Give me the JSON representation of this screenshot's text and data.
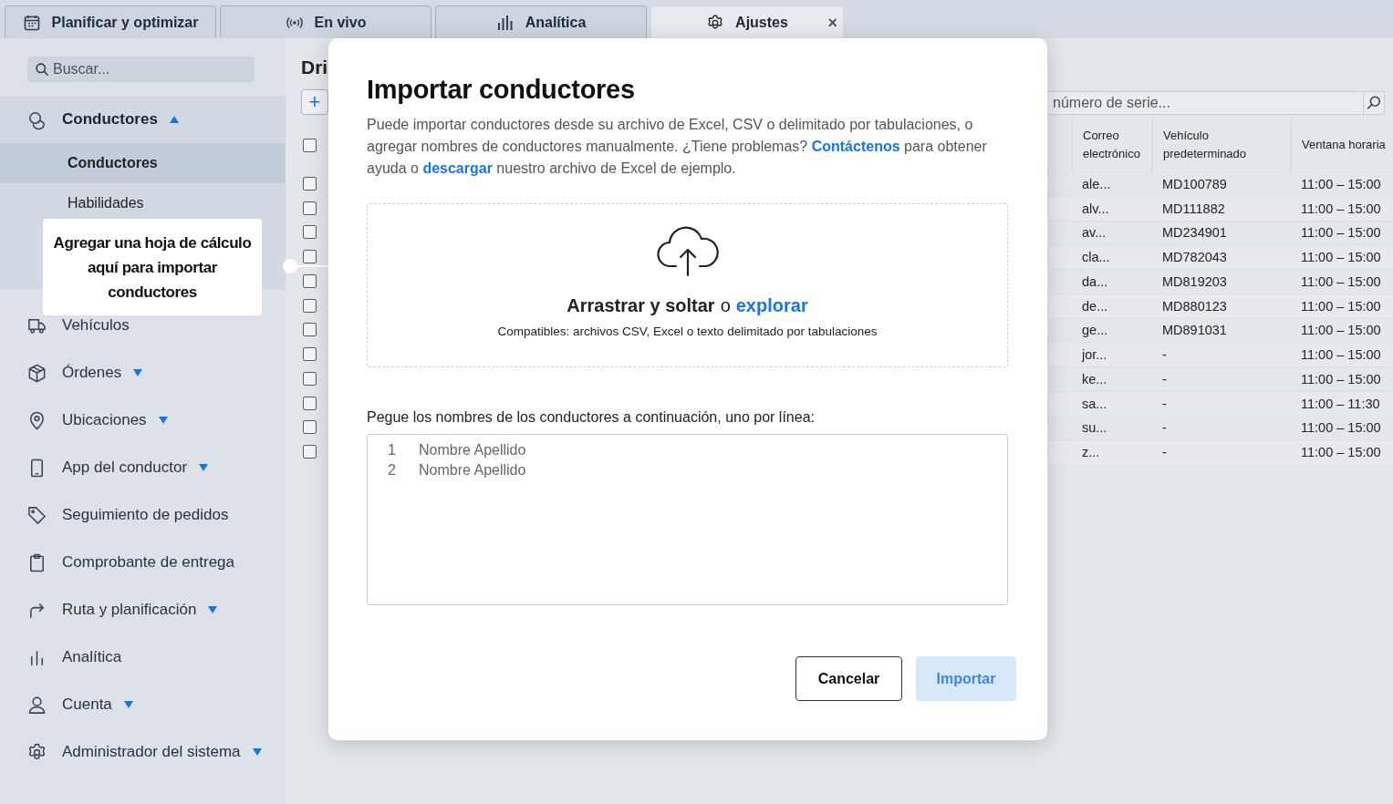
{
  "tabs": [
    {
      "label": "Planificar y optimizar",
      "selected": false
    },
    {
      "label": "En vivo",
      "selected": false
    },
    {
      "label": "Analítica",
      "selected": false
    },
    {
      "label": "Ajustes",
      "selected": true,
      "close": "×"
    }
  ],
  "sidebar": {
    "search": {
      "placeholder": "Buscar..."
    },
    "items": [
      {
        "label": "Conductores",
        "expanded": true,
        "children": [
          {
            "label": "Conductores",
            "selected": true
          },
          {
            "label": "Habilidades",
            "selected": false
          }
        ]
      },
      {
        "label": "Vehículos"
      },
      {
        "label": "Órdenes",
        "expanded": false
      },
      {
        "label": "Ubicaciones",
        "expanded": false
      },
      {
        "label": "App del conductor",
        "expanded": false
      },
      {
        "label": "Seguimiento de pedidos"
      },
      {
        "label": "Comprobante de entrega"
      },
      {
        "label": "Ruta y planificación",
        "expanded": false
      },
      {
        "label": "Analítica"
      },
      {
        "label": "Cuenta",
        "expanded": false
      },
      {
        "label": "Administrador del sistema",
        "expanded": false
      }
    ]
  },
  "tooltip": "Agregar una hoja de cálculo aquí para importar conductores",
  "page": {
    "title": "Dri",
    "add_button": "+",
    "search": {
      "placeholder": "número de serie..."
    },
    "table": {
      "header_checked": false,
      "columns": [
        "Correo electrónico",
        "Vehículo predeterminado",
        "Ventana horaria"
      ],
      "rows": [
        {
          "checked": false,
          "cells": [
            "ale...",
            "MD100789",
            "11:00 – 15:00"
          ]
        },
        {
          "checked": false,
          "cells": [
            "alv...",
            "MD111882",
            "11:00 – 15:00"
          ]
        },
        {
          "checked": false,
          "cells": [
            "av...",
            "MD234901",
            "11:00 – 15:00"
          ]
        },
        {
          "checked": false,
          "cells": [
            "cla...",
            "MD782043",
            "11:00 – 15:00"
          ]
        },
        {
          "checked": false,
          "cells": [
            "da...",
            "MD819203",
            "11:00 – 15:00"
          ]
        },
        {
          "checked": false,
          "cells": [
            "de...",
            "MD880123",
            "11:00 – 15:00"
          ]
        },
        {
          "checked": false,
          "cells": [
            "ge...",
            "MD891031",
            "11:00 – 15:00"
          ]
        },
        {
          "checked": false,
          "cells": [
            "jor...",
            "-",
            "11:00 – 15:00"
          ]
        },
        {
          "checked": false,
          "cells": [
            "ke...",
            "-",
            "11:00 – 15:00"
          ]
        },
        {
          "checked": false,
          "cells": [
            "sa...",
            "-",
            "11:00 – 11:30"
          ]
        },
        {
          "checked": false,
          "cells": [
            "su...",
            "-",
            "11:00 – 15:00"
          ]
        },
        {
          "checked": false,
          "cells": [
            "z...",
            "-",
            "11:00 – 15:00"
          ]
        }
      ]
    }
  },
  "dialog": {
    "title": "Importar conductores",
    "intro": [
      {
        "text": "Puede importar conductores desde su archivo de Excel, CSV o delimitado por tabulaciones, o agregar nombres de conductores manualmente. ¿Tiene problemas? ",
        "link": false
      },
      {
        "text": "Contáctenos",
        "link": true
      },
      {
        "text": " para obtener ayuda o ",
        "link": false
      },
      {
        "text": "descargar",
        "link": true
      },
      {
        "text": " nuestro archivo de Excel de ejemplo.",
        "link": false
      }
    ],
    "drop": {
      "text": "Arrastrar y soltar",
      "joiner": "o",
      "link": "explorar",
      "formats": "Compatibles: archivos CSV, Excel o texto delimitado por tabulaciones"
    },
    "paste_label": "Pegue los nombres de los conductores a continuación, uno por línea:",
    "lines": [
      {
        "number": "1",
        "placeholder": "Nombre Apellido"
      },
      {
        "number": "2",
        "placeholder": "Nombre Apellido"
      }
    ],
    "buttons": [
      {
        "label": "Cancelar",
        "kind": "secondary",
        "disabled": false
      },
      {
        "label": "Importar",
        "kind": "primary",
        "disabled": true
      }
    ]
  }
}
